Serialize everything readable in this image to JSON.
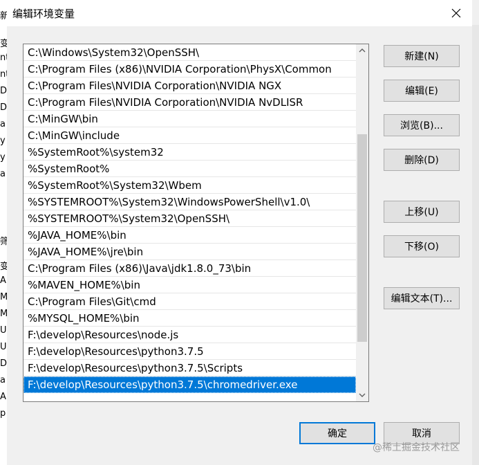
{
  "window": {
    "title": "编辑环境变量"
  },
  "paths": [
    "C:\\Windows\\System32\\OpenSSH\\",
    "C:\\Program Files (x86)\\NVIDIA Corporation\\PhysX\\Common",
    "C:\\Program Files\\NVIDIA Corporation\\NVIDIA NGX",
    "C:\\Program Files\\NVIDIA Corporation\\NVIDIA NvDLISR",
    "C:\\MinGW\\bin",
    "C:\\MinGW\\include",
    "%SystemRoot%\\system32",
    "%SystemRoot%",
    "%SystemRoot%\\System32\\Wbem",
    "%SYSTEMROOT%\\System32\\WindowsPowerShell\\v1.0\\",
    "%SYSTEMROOT%\\System32\\OpenSSH\\",
    "%JAVA_HOME%\\bin",
    "%JAVA_HOME%\\jre\\bin",
    "C:\\Program Files (x86)\\Java\\jdk1.8.0_73\\bin",
    "%MAVEN_HOME%\\bin",
    "C:\\Program Files\\Git\\cmd",
    "%MYSQL_HOME%\\bin",
    "F:\\develop\\Resources\\node.js",
    "F:\\develop\\Resources\\python3.7.5",
    "F:\\develop\\Resources\\python3.7.5\\Scripts",
    "F:\\develop\\Resources\\python3.7.5\\chromedriver.exe"
  ],
  "selected_index": 20,
  "scroll": {
    "position": 0.62
  },
  "buttons": {
    "new": "新建(N)",
    "edit": "编辑(E)",
    "browse": "浏览(B)...",
    "delete": "删除(D)",
    "move_up": "上移(U)",
    "move_down": "下移(O)",
    "edit_text": "编辑文本(T)...",
    "ok": "确定",
    "cancel": "取消"
  },
  "watermark": "@稀土掘金技术社区",
  "background_fragments": [
    "新",
    "变",
    "nt",
    "nt",
    "Dr",
    "Dr",
    "a",
    "y",
    "y",
    "a",
    "筛",
    "变",
    "A",
    "M",
    "M",
    "U",
    "U",
    "DS",
    "a",
    "A",
    "p"
  ],
  "colors": {
    "accent": "#0078d7",
    "face": "#f0f0f0",
    "button": "#e1e1e1"
  }
}
